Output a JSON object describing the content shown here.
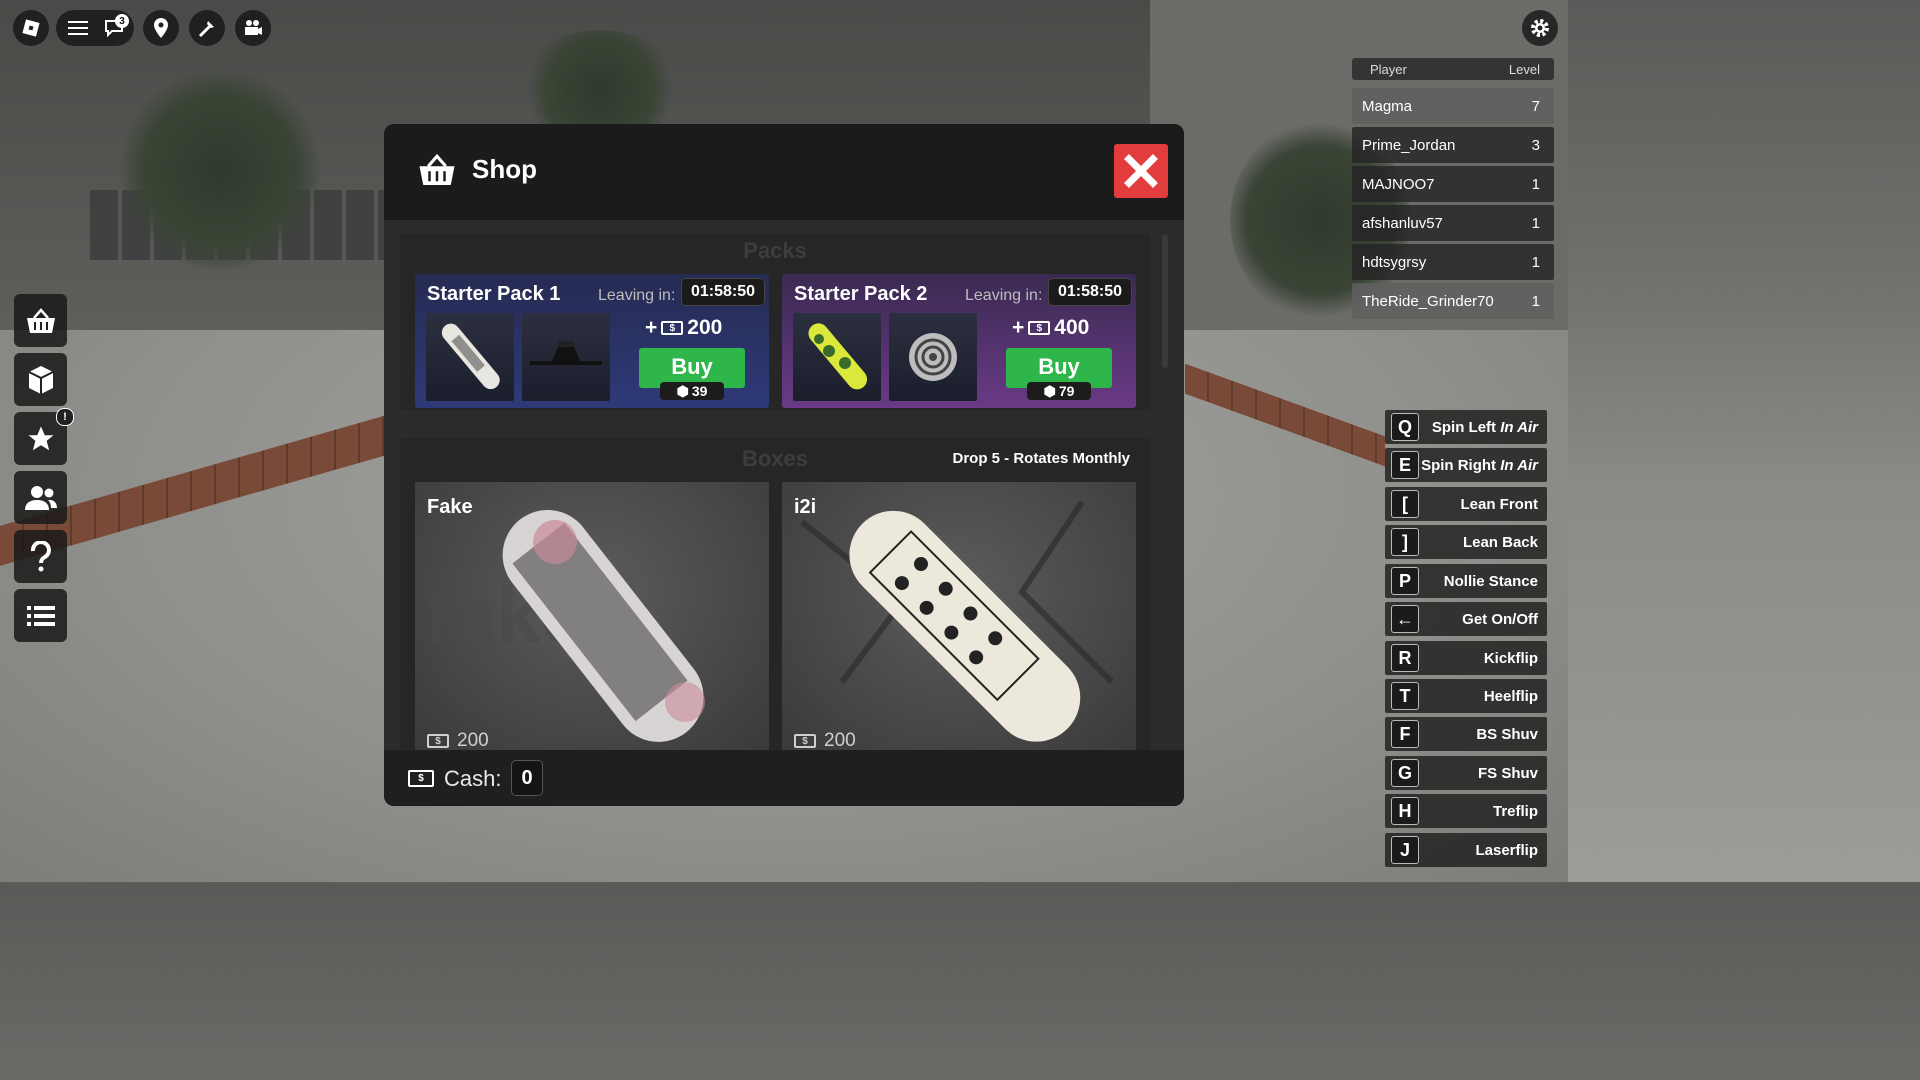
{
  "topbar": {
    "notification_count": "3"
  },
  "leaderboard": {
    "header": {
      "player": "Player",
      "level": "Level"
    },
    "rows": [
      {
        "name": "Magma",
        "level": "7"
      },
      {
        "name": "Prime_Jordan",
        "level": "3"
      },
      {
        "name": "MAJNOO7",
        "level": "1"
      },
      {
        "name": "afshanluv57",
        "level": "1"
      },
      {
        "name": "hdtsygrsy",
        "level": "1"
      },
      {
        "name": "TheRide_Grinder70",
        "level": "1"
      }
    ]
  },
  "sidebar": {
    "notice_badge": "!"
  },
  "controls": [
    {
      "key": "Q",
      "label": "Spin Left ",
      "suffix": "In Air"
    },
    {
      "key": "E",
      "label": "Spin Right ",
      "suffix": "In Air"
    },
    {
      "key": "[",
      "label": "Lean Front",
      "suffix": ""
    },
    {
      "key": "]",
      "label": "Lean Back",
      "suffix": ""
    },
    {
      "key": "P",
      "label": "Nollie Stance",
      "suffix": ""
    },
    {
      "key": "←",
      "label": "Get On/Off",
      "suffix": ""
    },
    {
      "key": "R",
      "label": "Kickflip",
      "suffix": ""
    },
    {
      "key": "T",
      "label": "Heelflip",
      "suffix": ""
    },
    {
      "key": "F",
      "label": "BS Shuv",
      "suffix": ""
    },
    {
      "key": "G",
      "label": "FS Shuv",
      "suffix": ""
    },
    {
      "key": "H",
      "label": "Treflip",
      "suffix": ""
    },
    {
      "key": "J",
      "label": "Laserflip",
      "suffix": ""
    }
  ],
  "shop": {
    "title": "Shop",
    "packs_title": "Packs",
    "packs": [
      {
        "name": "Starter Pack 1",
        "leaving_label": "Leaving in:",
        "timer": "01:58:50",
        "cash": "200",
        "buy_label": "Buy",
        "robux": "39"
      },
      {
        "name": "Starter Pack 2",
        "leaving_label": "Leaving in:",
        "timer": "01:58:50",
        "cash": "400",
        "buy_label": "Buy",
        "robux": "79"
      }
    ],
    "boxes_title": "Boxes",
    "drop_label": "Drop 5 - Rotates Monthly",
    "boxes": [
      {
        "name": "Fake",
        "price": "200"
      },
      {
        "name": "i2i",
        "price": "200"
      }
    ],
    "cash_label": "Cash:",
    "cash_value": "0"
  },
  "colors": {
    "buy_green": "#2fb64a",
    "close_red": "#e23c3c",
    "pack2_purple": "#6a3a86",
    "pack1_blue": "#2e3a78"
  }
}
